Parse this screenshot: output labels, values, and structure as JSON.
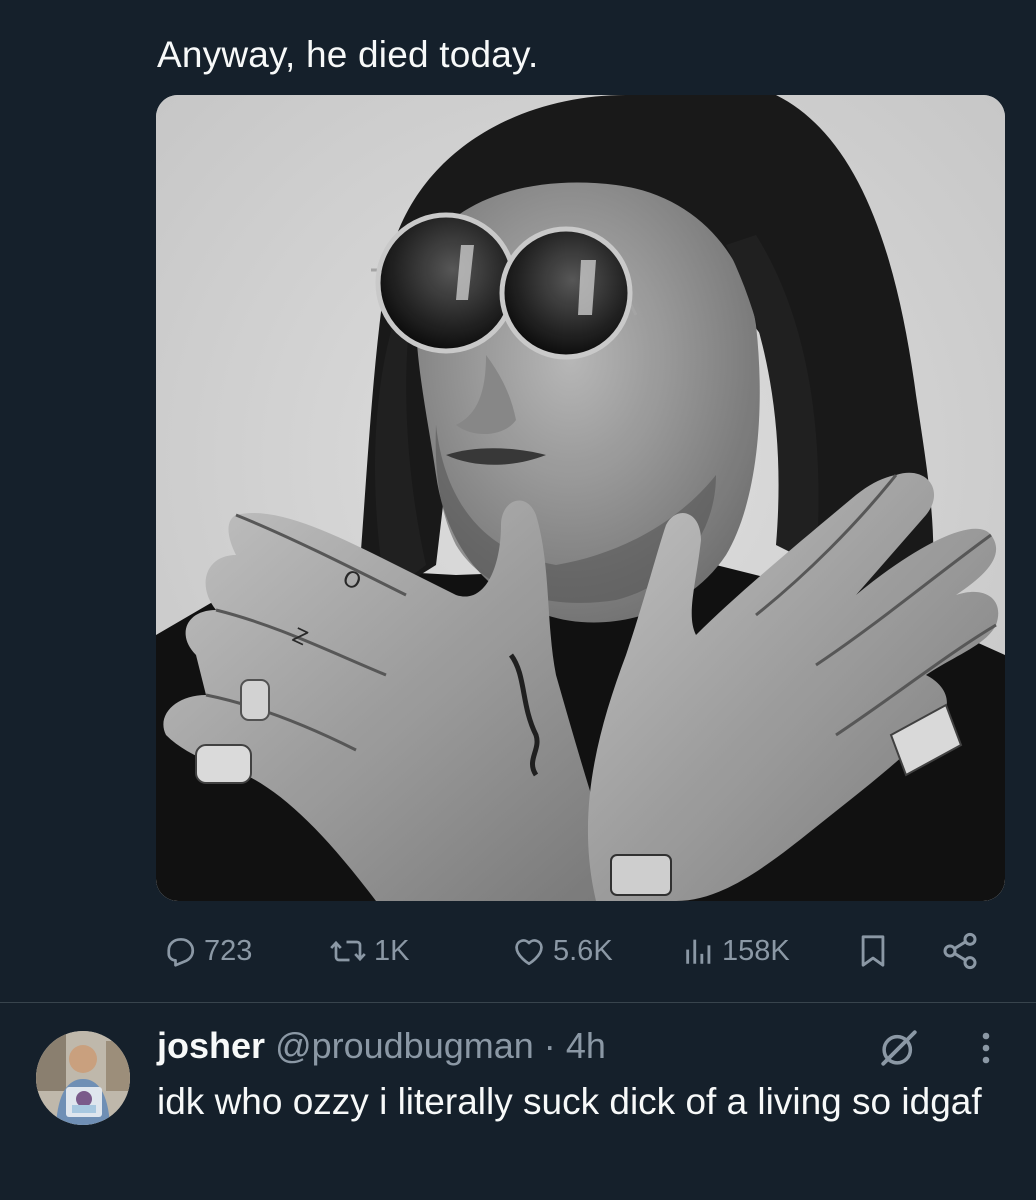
{
  "tweet": {
    "text": "Anyway, he died today.",
    "media_alt": "black and white portrait photo of a man with long dark hair and round sunglasses crossing his hands"
  },
  "actions": {
    "replies": {
      "icon": "reply-icon",
      "count": "723"
    },
    "reposts": {
      "icon": "repost-icon",
      "count": "1K"
    },
    "likes": {
      "icon": "like-icon",
      "count": "5.6K"
    },
    "views": {
      "icon": "views-icon",
      "count": "158K"
    },
    "bookmark": {
      "icon": "bookmark-icon"
    },
    "share": {
      "icon": "share-icon"
    }
  },
  "reply": {
    "name": "josher",
    "handle": "@proudbugman",
    "separator": "·",
    "time": "4h",
    "text": "idk who ozzy i literally suck dick of a living so idgaf",
    "grok_icon": "grok-icon",
    "more_icon": "more-icon"
  },
  "colors": {
    "background": "#15202b",
    "text": "#f7f9f9",
    "secondary": "#8b98a5",
    "divider": "#38444d"
  }
}
